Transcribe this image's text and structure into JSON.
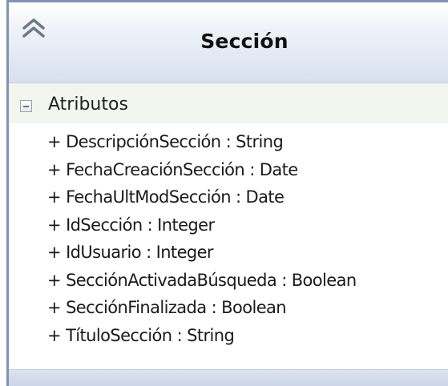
{
  "class": {
    "name": "Sección",
    "collapse_icon": "double-chevron-up-icon"
  },
  "attributes": {
    "label": "Atributos",
    "toggle_icon": "minus-box-icon",
    "items": [
      "+ DescripciónSección : String",
      "+ FechaCreaciónSección : Date",
      "+ FechaUltModSección : Date",
      "+ IdSección : Integer",
      "+ IdUsuario : Integer",
      "+ SecciónActivadaBúsqueda : Boolean",
      "+ SecciónFinalizada : Boolean",
      "+ TítuloSección : String"
    ]
  },
  "colors": {
    "border": "#7f93b3",
    "header_gradient_end": "#d7e0ee",
    "section_header_bg": "#f2f6ee"
  }
}
